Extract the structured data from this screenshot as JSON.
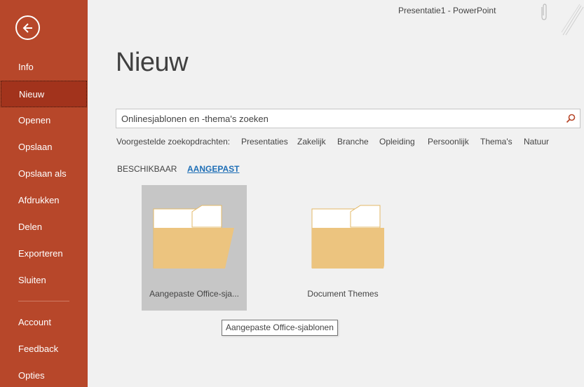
{
  "window": {
    "title": "Presentatie1  -  PowerPoint"
  },
  "sidebar": {
    "back_icon": "arrow-left-circle-icon",
    "items": [
      {
        "label": "Info",
        "active": false
      },
      {
        "label": "Nieuw",
        "active": true
      },
      {
        "label": "Openen",
        "active": false
      },
      {
        "label": "Opslaan",
        "active": false
      },
      {
        "label": "Opslaan als",
        "active": false
      },
      {
        "label": "Afdrukken",
        "active": false
      },
      {
        "label": "Delen",
        "active": false
      },
      {
        "label": "Exporteren",
        "active": false
      },
      {
        "label": "Sluiten",
        "active": false
      },
      {
        "label": "Account",
        "active": false
      },
      {
        "label": "Feedback",
        "active": false
      },
      {
        "label": "Opties",
        "active": false
      }
    ],
    "color": "#b7472a",
    "active_color": "#a2331c"
  },
  "main": {
    "title": "Nieuw",
    "search": {
      "placeholder": "Onlinesjablonen en -thema's zoeken",
      "value": "",
      "icon": "search-icon"
    },
    "suggestions": {
      "label": "Voorgestelde zoekopdrachten:",
      "items": [
        "Presentaties",
        "Zakelijk",
        "Branche",
        "Opleiding",
        "Persoonlijk",
        "Thema's",
        "Natuur"
      ]
    },
    "tabs": [
      {
        "label": "BESCHIKBAAR",
        "active": false
      },
      {
        "label": "AANGEPAST",
        "active": true
      }
    ],
    "folders": [
      {
        "label": "Aangepaste Office-sja...",
        "selected": true,
        "icon": "folder-icon"
      },
      {
        "label": "Document Themes",
        "selected": false,
        "icon": "folder-icon"
      }
    ],
    "tooltip": "Aangepaste Office-sjablonen",
    "accent_link_color": "#1f6fb6",
    "folder_color": "#ecc47f"
  }
}
